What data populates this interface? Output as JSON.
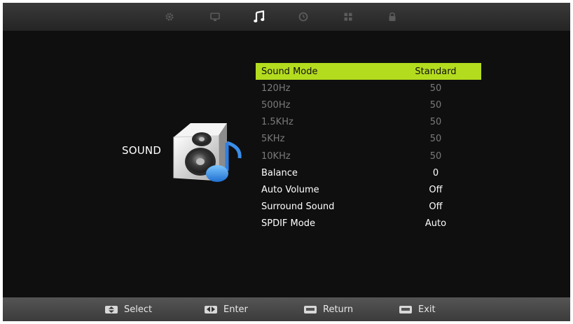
{
  "tabs": [
    {
      "icon": "gear-icon",
      "active": false
    },
    {
      "icon": "monitor-icon",
      "active": false
    },
    {
      "icon": "music-note-icon",
      "active": true
    },
    {
      "icon": "clock-icon",
      "active": false
    },
    {
      "icon": "grid-icon",
      "active": false
    },
    {
      "icon": "lock-icon",
      "active": false
    }
  ],
  "section": {
    "title": "SOUND",
    "icon": "speaker-music-icon"
  },
  "menu": [
    {
      "label": "Sound Mode",
      "value": "Standard",
      "state": "selected"
    },
    {
      "label": "120Hz",
      "value": "50",
      "state": "disabled"
    },
    {
      "label": "500Hz",
      "value": "50",
      "state": "disabled"
    },
    {
      "label": "1.5KHz",
      "value": "50",
      "state": "disabled"
    },
    {
      "label": "5KHz",
      "value": "50",
      "state": "disabled"
    },
    {
      "label": "10KHz",
      "value": "50",
      "state": "disabled"
    },
    {
      "label": "Balance",
      "value": "0",
      "state": "normal"
    },
    {
      "label": "Auto Volume",
      "value": "Off",
      "state": "normal"
    },
    {
      "label": "Surround Sound",
      "value": "Off",
      "state": "normal"
    },
    {
      "label": "SPDIF Mode",
      "value": "Auto",
      "state": "normal"
    }
  ],
  "hints": [
    {
      "icon": "up-down-key-icon",
      "label": "Select"
    },
    {
      "icon": "left-right-key-icon",
      "label": "Enter"
    },
    {
      "icon": "menu-key-icon",
      "label": "Return"
    },
    {
      "icon": "exit-key-icon",
      "label": "Exit"
    }
  ],
  "colors": {
    "highlight": "#b4dc1e",
    "background": "#0f0f0f",
    "disabled_text": "#7a7a7a"
  }
}
